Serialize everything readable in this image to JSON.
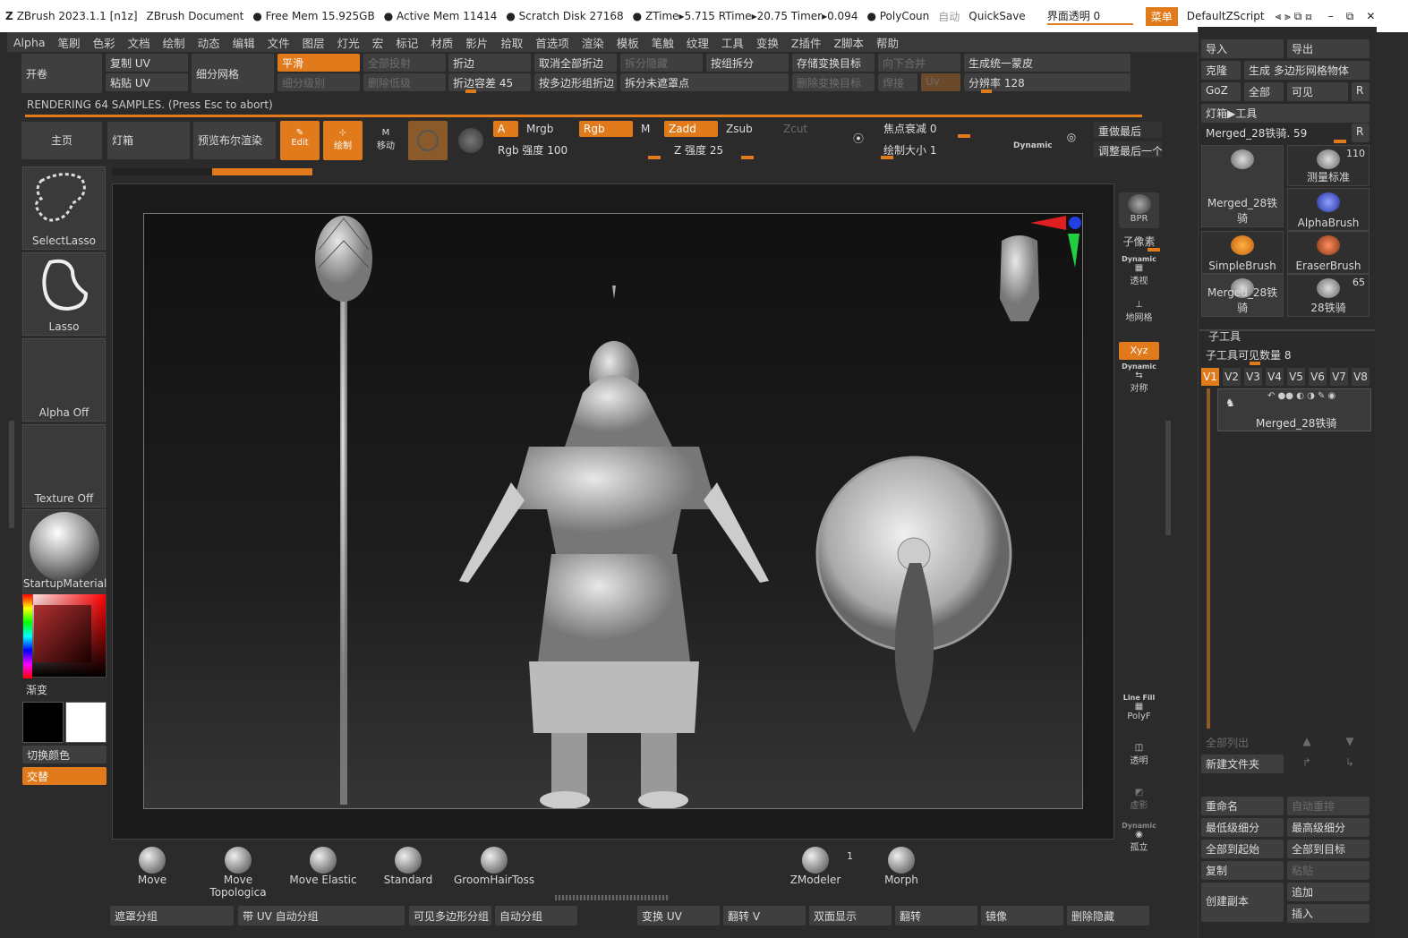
{
  "titlebar": {
    "app": "ZBrush 2023.1.1 [n1z]",
    "doc": "ZBrush Document",
    "free_mem": "Free Mem 15.925GB",
    "active_mem": "Active Mem 11414",
    "scratch": "Scratch Disk 27168",
    "ztime": "ZTime▸5.715 RTime▸20.75 Timer▸0.094",
    "polycount": "PolyCoun",
    "auto": "自动",
    "quicksave": "QuickSave",
    "transparency": "界面透明 0",
    "menu": "菜单",
    "script": "DefaultZScript"
  },
  "menu": [
    "Alpha",
    "笔刷",
    "色彩",
    "文档",
    "绘制",
    "动态",
    "编辑",
    "文件",
    "图层",
    "灯光",
    "宏",
    "标记",
    "材质",
    "影片",
    "拾取",
    "首选项",
    "渲染",
    "模板",
    "笔触",
    "纹理",
    "工具",
    "变换",
    "Z插件",
    "Z脚本",
    "帮助"
  ],
  "shelf": {
    "open": "开卷",
    "copy_uv": "复制 UV",
    "paste_uv": "粘贴 UV",
    "subdiv_mesh": "细分网格",
    "smooth": "平滑",
    "subdiv_level": "细分级别",
    "project_all": "全部投射",
    "del_lower": "删除低级",
    "crease": "折边",
    "crease_tol": "折边容差 45",
    "uncrease_all": "取消全部折边",
    "crease_pg": "按多边形组折边",
    "split_hidden": "拆分隐藏",
    "split_unmasked": "拆分未遮罩点",
    "group_split": "按组拆分",
    "store_morph": "存储变换目标",
    "del_morph": "删除变换目标",
    "merge_down": "向下合并",
    "weld": "焊接",
    "uv": "Uv",
    "unify_skin": "生成统一蒙皮",
    "resolution": "分辨率 128"
  },
  "render_msg": "RENDERING 64 SAMPLES. (Press Esc to abort)",
  "toolbar": {
    "home": "主页",
    "lightbox": "灯箱",
    "bpr_preview": "预览布尔渲染",
    "edit": "Edit",
    "draw": "绘制",
    "move": "移动",
    "a": "A",
    "mrgb": "Mrgb",
    "rgb": "Rgb",
    "m": "M",
    "zadd": "Zadd",
    "zsub": "Zsub",
    "zcut": "Zcut",
    "rgb_intensity": "Rgb 强度 100",
    "z_intensity": "Z 强度 25",
    "focal_shift": "焦点衰减 0",
    "draw_size": "绘制大小 1",
    "dynamic": "Dynamic",
    "redo": "重做最后",
    "adjust_last": "调整最后一个"
  },
  "left": {
    "select_lasso": "SelectLasso",
    "lasso": "Lasso",
    "alpha_off": "Alpha Off",
    "texture_off": "Texture Off",
    "material": "StartupMaterial",
    "gradient": "渐变",
    "switch_color": "切换颜色",
    "alternate": "交替",
    "accent": "#e07a1a"
  },
  "brushes": [
    {
      "label": "Move"
    },
    {
      "label": "Move Topologica"
    },
    {
      "label": "Move Elastic"
    },
    {
      "label": "Standard"
    },
    {
      "label": "GroomHairToss"
    },
    {
      "label": "ZModeler"
    },
    {
      "label": "Morph"
    }
  ],
  "zmodeler_count": "1",
  "bottom": {
    "mask_groups": "遮罩分组",
    "uv_auto": "带 UV 自动分组",
    "visible_pg": "可见多边形分组",
    "auto_groups": "自动分组",
    "uv_morph": "变换 UV",
    "flip_v": "翻转 V",
    "double": "双面显示",
    "flip": "翻转",
    "mirror": "镜像",
    "del_hidden": "删除隐藏"
  },
  "righttools": {
    "bpr": "BPR",
    "subpixel": "子像素",
    "dynamic": "Dynamic",
    "persp": "透视",
    "floor": "地网格",
    "xyz": "Xyz",
    "sym": "对称",
    "linefill": "Line Fill",
    "polyf": "PolyF",
    "transp": "透明",
    "ghost": "虚影",
    "solo": "孤立"
  },
  "rightpanel": {
    "import": "导入",
    "export": "导出",
    "clone": "克隆",
    "make_polymesh": "生成 多边形网格物体",
    "goz": "GoZ",
    "all": "全部",
    "visible": "可见",
    "r": "R",
    "lightbox_tool": "灯箱▶工具",
    "merged_slider": "Merged_28铁骑. 59",
    "tools": [
      {
        "label": "Merged_28铁骑",
        "count": ""
      },
      {
        "label": "测量标准",
        "count": "110"
      },
      {
        "label": "AlphaBrush",
        "count": ""
      },
      {
        "label": "SimpleBrush",
        "count": ""
      },
      {
        "label": "EraserBrush",
        "count": ""
      },
      {
        "label": "Merged_28铁骑",
        "count": ""
      },
      {
        "label": "28铁骑",
        "count": "65"
      }
    ],
    "subtool": "子工具",
    "subtool_visible": "子工具可见数量 8",
    "versions": [
      "V1",
      "V2",
      "V3",
      "V4",
      "V5",
      "V6",
      "V7",
      "V8"
    ],
    "subtool_item": "Merged_28铁骑",
    "list_all": "全部列出",
    "new_folder": "新建文件夹",
    "rename": "重命名",
    "auto_reorder": "自动重排",
    "lowest": "最低级细分",
    "highest": "最高级细分",
    "all_start": "全部到起始",
    "all_target": "全部到目标",
    "copy": "复制",
    "paste": "粘贴",
    "duplicate": "创建副本",
    "append": "追加",
    "insert": "插入"
  }
}
